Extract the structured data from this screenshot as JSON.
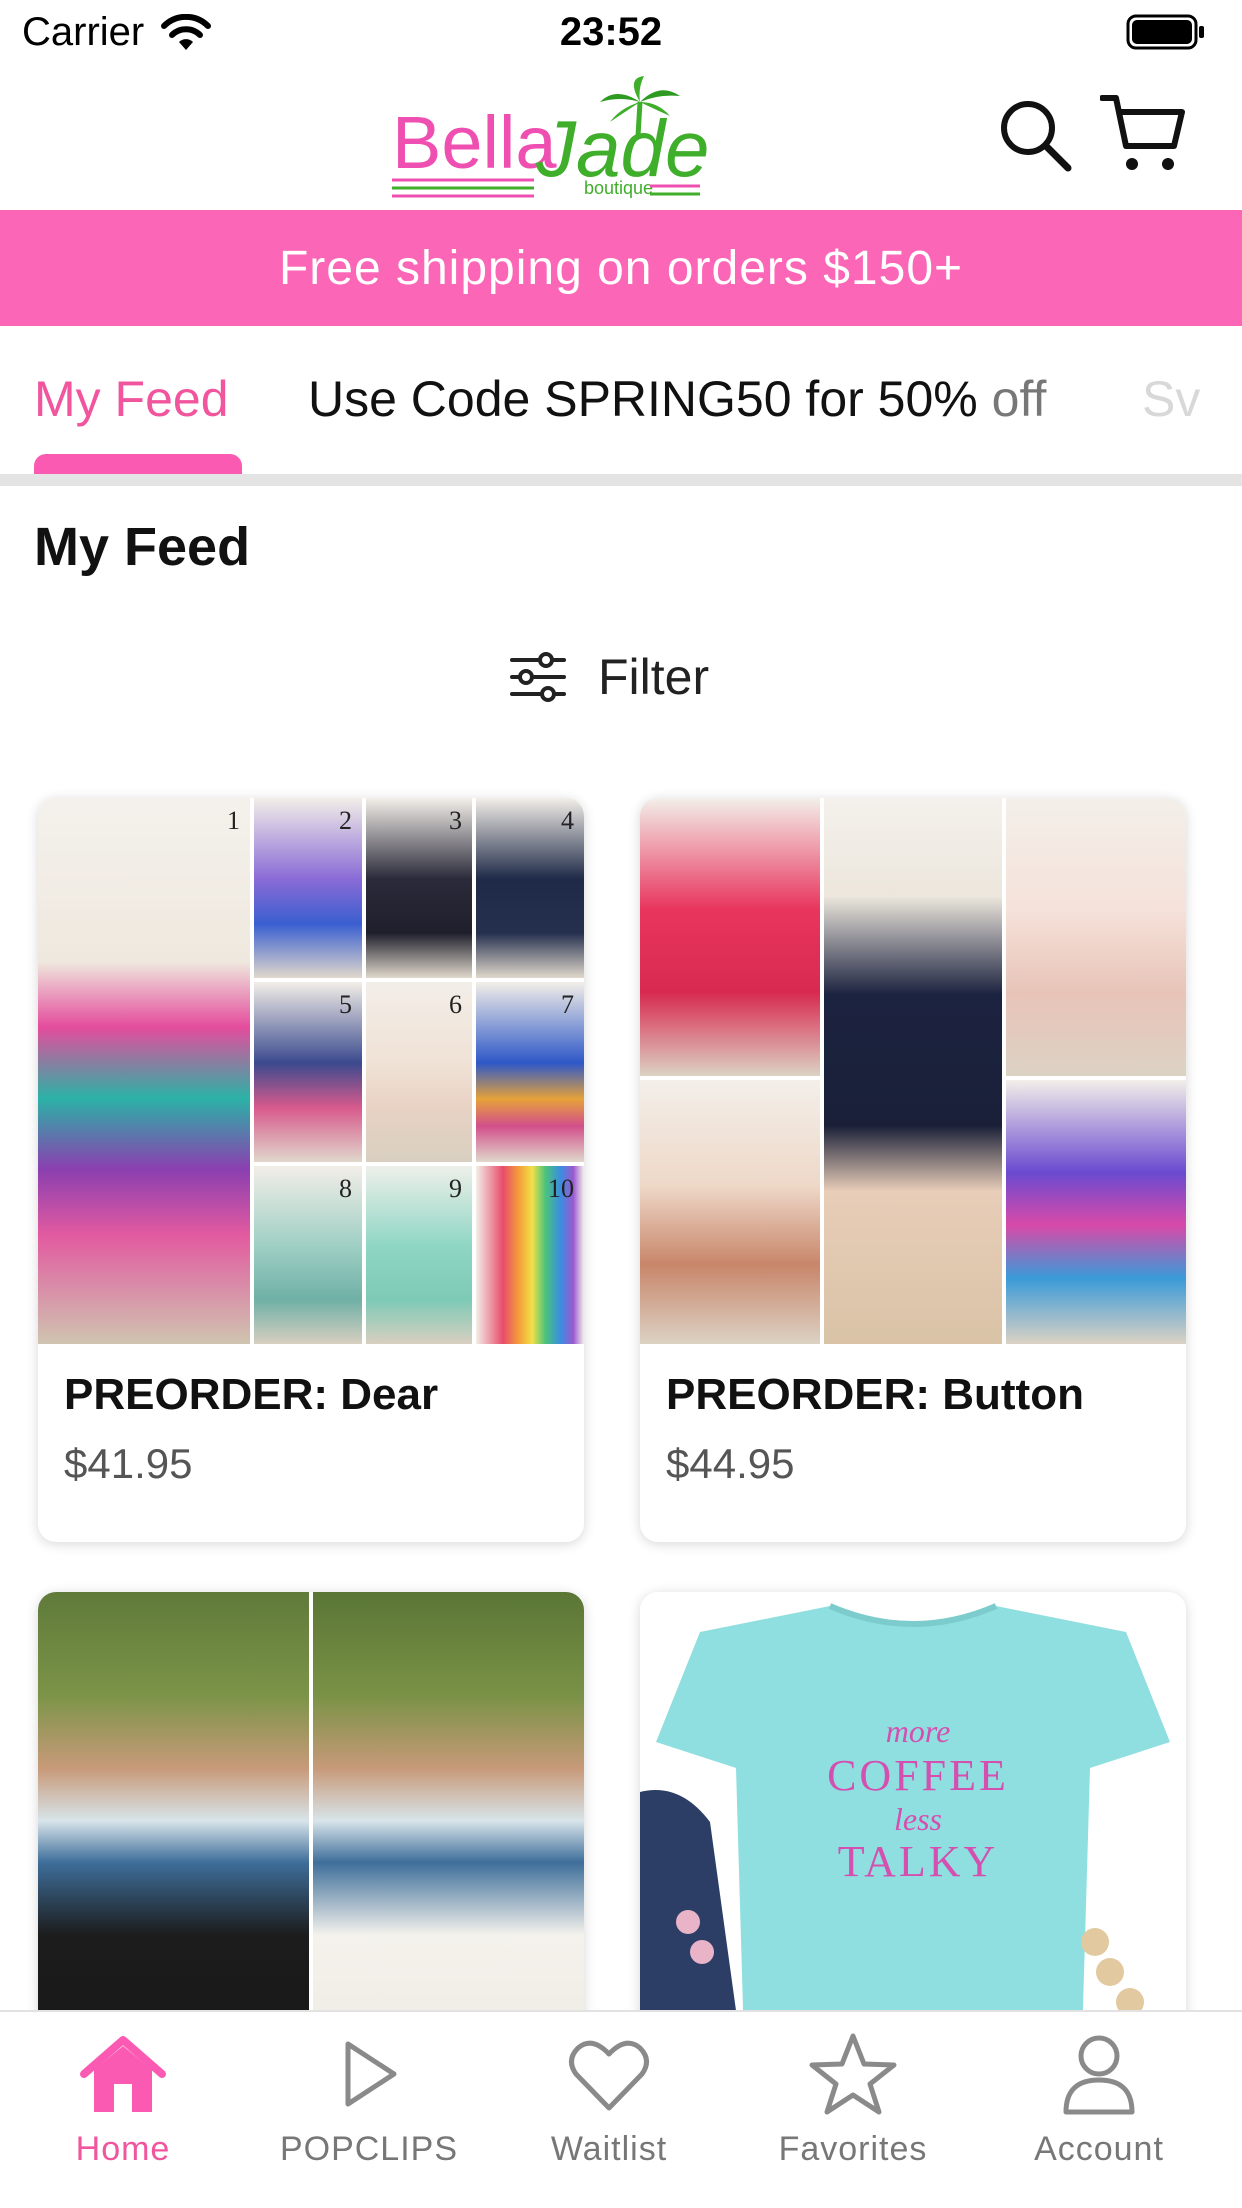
{
  "status_bar": {
    "carrier": "Carrier",
    "time": "23:52"
  },
  "header": {
    "logo_text_bella": "Bella",
    "logo_text_jade": "Jade",
    "logo_sub": "boutique",
    "search_icon": "search-icon",
    "cart_icon": "cart-icon"
  },
  "promo": {
    "text": "Free shipping on orders $150+"
  },
  "tabs": {
    "my_feed": "My Feed",
    "code_main": "Use Code SPRING50 for 50%",
    "code_tail": " off",
    "third": "Sv"
  },
  "main": {
    "section_title": "My Feed",
    "filter_label": "Filter"
  },
  "products": [
    {
      "name": "PREORDER: Dear",
      "price": "$41.95",
      "tile_numbers": [
        "1",
        "2",
        "3",
        "4",
        "5",
        "6",
        "7",
        "8",
        "9",
        "10"
      ]
    },
    {
      "name": "PREORDER: Button",
      "price": "$44.95"
    },
    {
      "name": "",
      "price": ""
    },
    {
      "name": "",
      "price": "",
      "shirt_text": [
        "more",
        "COFFEE",
        "less",
        "TALKY"
      ]
    }
  ],
  "tab_bar": {
    "home": "Home",
    "popclips": "POPCLIPS",
    "waitlist": "Waitlist",
    "favorites": "Favorites",
    "account": "Account"
  },
  "colors": {
    "brand_pink": "#fb66b6",
    "active_pink": "#f0559e",
    "logo_green": "#3fae2a"
  }
}
